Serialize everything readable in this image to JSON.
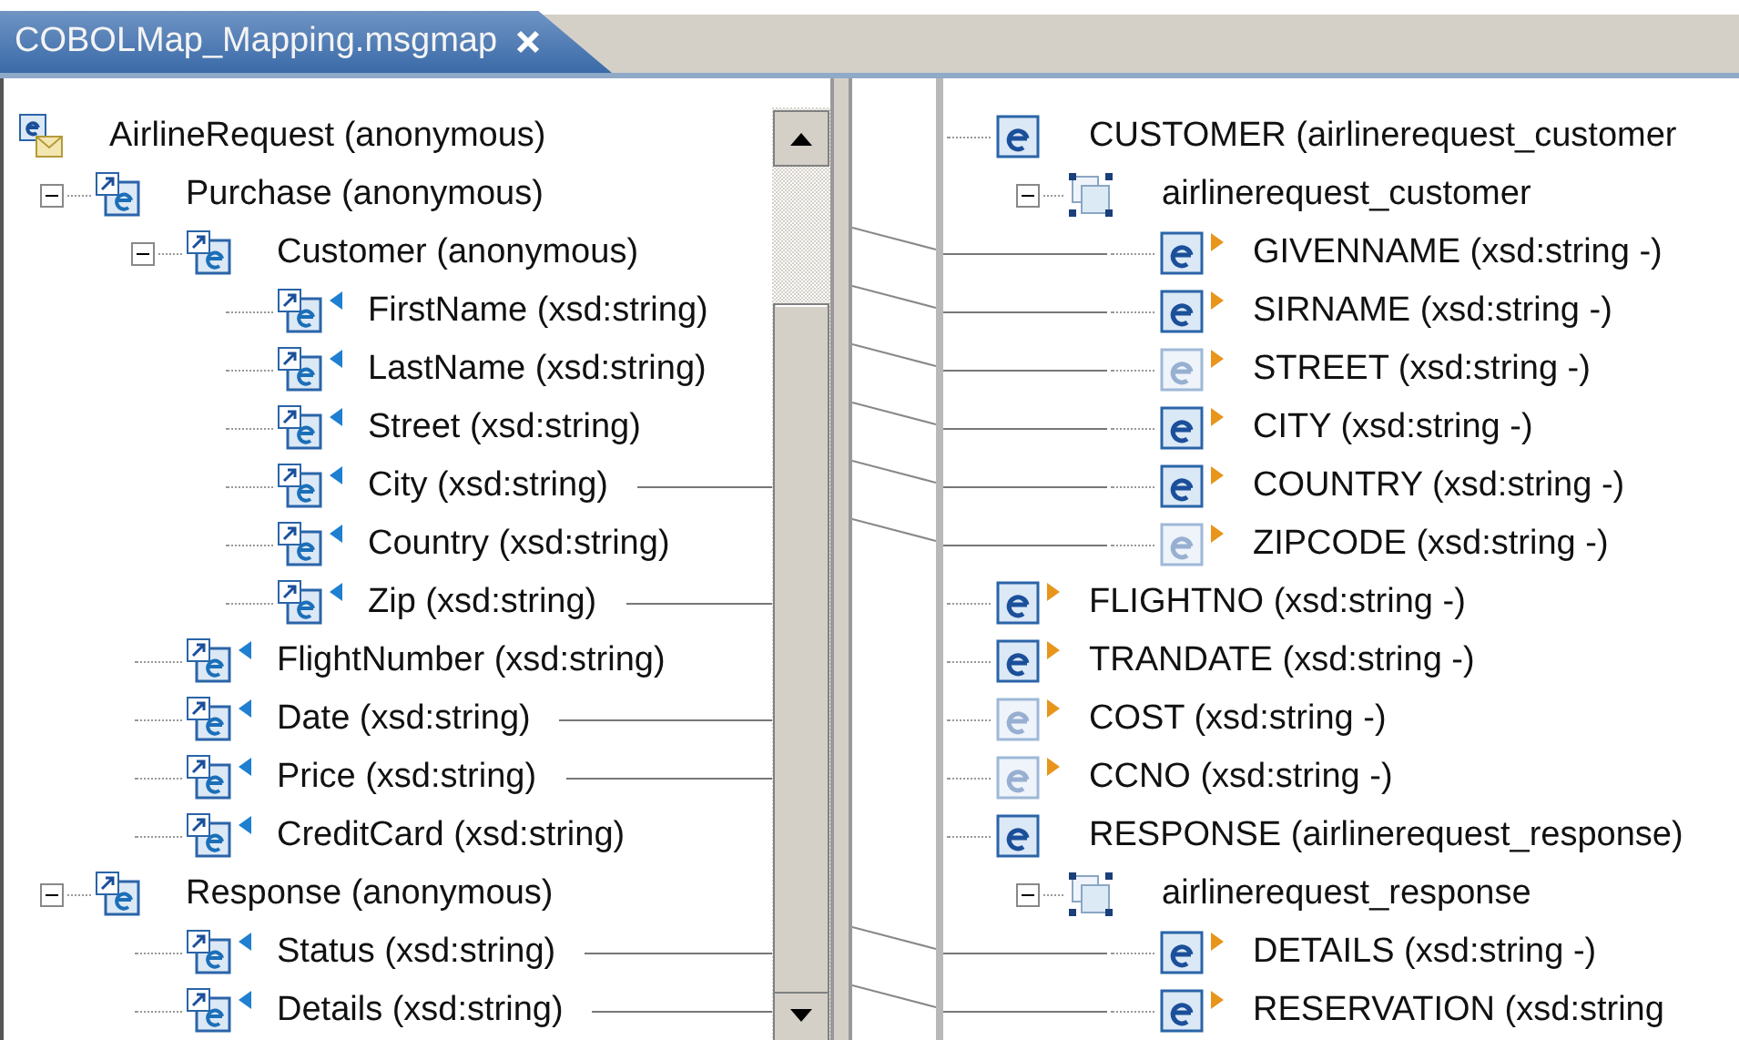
{
  "tab": {
    "title": "COBOLMap_Mapping.msgmap",
    "selected": true
  },
  "left_tree": [
    {
      "label": "AirlineRequest (anonymous)",
      "kind": "message",
      "marker": false,
      "linked": false,
      "children": [
        {
          "label": "Purchase (anonymous)",
          "kind": "group",
          "expanded": true,
          "marker": false,
          "linked": false,
          "children": [
            {
              "label": "Customer (anonymous)",
              "kind": "group",
              "expanded": true,
              "marker": false,
              "linked": false,
              "children": [
                {
                  "label": "FirstName (xsd:string)",
                  "kind": "group",
                  "marker": true,
                  "linked": false
                },
                {
                  "label": "LastName (xsd:string)",
                  "kind": "group",
                  "marker": true,
                  "linked": false
                },
                {
                  "label": "Street (xsd:string)",
                  "kind": "group",
                  "marker": true,
                  "linked": false
                },
                {
                  "label": "City (xsd:string)",
                  "kind": "group",
                  "marker": true,
                  "linked": true
                },
                {
                  "label": "Country (xsd:string)",
                  "kind": "group",
                  "marker": true,
                  "linked": false
                },
                {
                  "label": "Zip (xsd:string)",
                  "kind": "group",
                  "marker": true,
                  "linked": true
                }
              ]
            },
            {
              "label": "FlightNumber (xsd:string)",
              "kind": "group",
              "marker": true,
              "linked": false
            },
            {
              "label": "Date (xsd:string)",
              "kind": "group",
              "marker": true,
              "linked": true
            },
            {
              "label": "Price (xsd:string)",
              "kind": "group",
              "marker": true,
              "linked": true
            },
            {
              "label": "CreditCard (xsd:string)",
              "kind": "group",
              "marker": true,
              "linked": false
            }
          ]
        },
        {
          "label": "Response (anonymous)",
          "kind": "group",
          "expanded": true,
          "marker": false,
          "linked": false,
          "children": [
            {
              "label": "Status (xsd:string)",
              "kind": "group",
              "marker": true,
              "linked": true
            },
            {
              "label": "Details (xsd:string)",
              "kind": "group",
              "marker": true,
              "linked": true
            }
          ]
        }
      ]
    }
  ],
  "right_tree": [
    {
      "label": "CUSTOMER (airlinerequest_customer",
      "kind": "element",
      "faded": false,
      "marker": false,
      "linked": false,
      "children": [
        {
          "label": "airlinerequest_customer",
          "kind": "type",
          "expanded": true,
          "faded": false,
          "marker": false,
          "linked": false,
          "children": [
            {
              "label": "GIVENNAME (xsd:string -)",
              "kind": "element",
              "faded": false,
              "marker": true,
              "linked": true
            },
            {
              "label": "SIRNAME (xsd:string -)",
              "kind": "element",
              "faded": false,
              "marker": true,
              "linked": true
            },
            {
              "label": "STREET (xsd:string -)",
              "kind": "element",
              "faded": true,
              "marker": true,
              "linked": true
            },
            {
              "label": "CITY (xsd:string -)",
              "kind": "element",
              "faded": false,
              "marker": true,
              "linked": true
            },
            {
              "label": "COUNTRY (xsd:string -)",
              "kind": "element",
              "faded": false,
              "marker": true,
              "linked": true
            },
            {
              "label": "ZIPCODE (xsd:string -)",
              "kind": "element",
              "faded": true,
              "marker": true,
              "linked": true
            }
          ]
        }
      ]
    },
    {
      "label": "FLIGHTNO (xsd:string -)",
      "kind": "element",
      "faded": false,
      "marker": true,
      "linked": false
    },
    {
      "label": "TRANDATE (xsd:string -)",
      "kind": "element",
      "faded": false,
      "marker": true,
      "linked": false
    },
    {
      "label": "COST (xsd:string -)",
      "kind": "element",
      "faded": true,
      "marker": true,
      "linked": false
    },
    {
      "label": "CCNO (xsd:string -)",
      "kind": "element",
      "faded": true,
      "marker": true,
      "linked": false
    },
    {
      "label": "RESPONSE (airlinerequest_response)",
      "kind": "element",
      "faded": false,
      "marker": false,
      "linked": false,
      "children": [
        {
          "label": "airlinerequest_response",
          "kind": "type",
          "expanded": true,
          "faded": false,
          "marker": false,
          "linked": false,
          "children": [
            {
              "label": "DETAILS (xsd:string -)",
              "kind": "element",
              "faded": false,
              "marker": true,
              "linked": true
            },
            {
              "label": "RESERVATION (xsd:string",
              "kind": "element",
              "faded": false,
              "marker": true,
              "linked": true
            }
          ]
        }
      ]
    }
  ]
}
